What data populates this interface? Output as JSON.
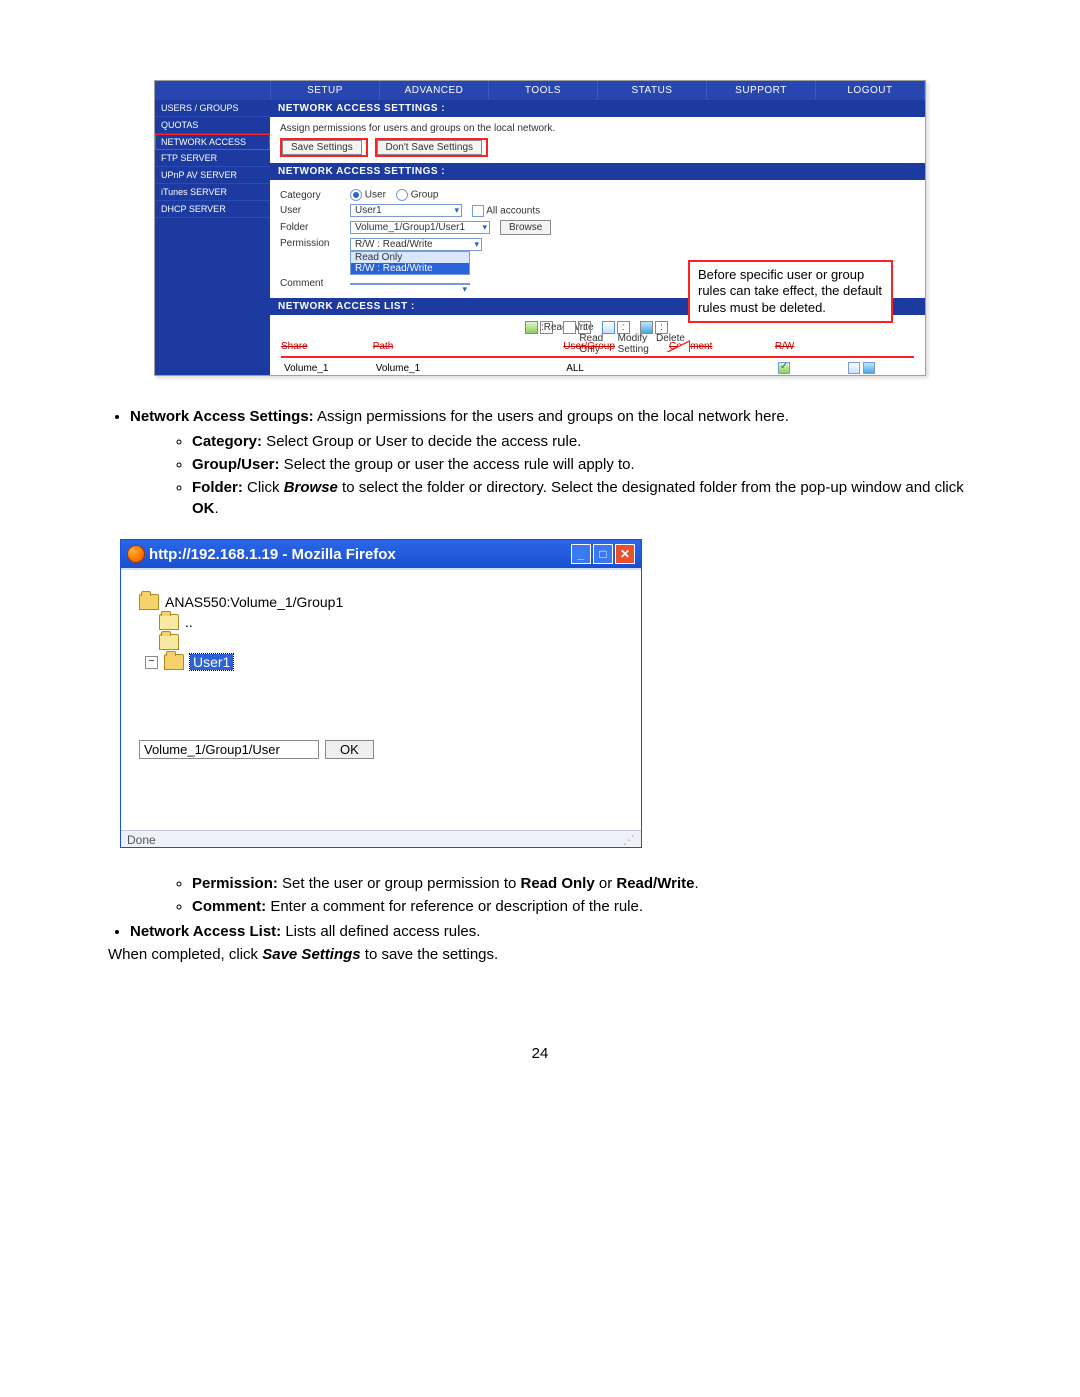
{
  "pageNumber": "24",
  "shot1": {
    "topnav": [
      "SETUP",
      "ADVANCED",
      "TOOLS",
      "STATUS",
      "SUPPORT",
      "LOGOUT"
    ],
    "side": [
      "USERS / GROUPS",
      "QUOTAS",
      "NETWORK ACCESS",
      "FTP SERVER",
      "UPnP AV SERVER",
      "iTunes SERVER",
      "DHCP SERVER"
    ],
    "sideActiveIndex": 2,
    "nas_title": "NETWORK ACCESS SETTINGS :",
    "nas_sub": "Assign permissions for users and groups on the local network.",
    "btn_save": "Save Settings",
    "btn_dontsave": "Don't Save Settings",
    "form": {
      "category_lbl": "Category",
      "user_radio": "User",
      "group_radio": "Group",
      "user_lbl": "User",
      "user_val": "User1",
      "all_accounts": "All accounts",
      "folder_lbl": "Folder",
      "folder_val": "Volume_1/Group1/User1",
      "browse": "Browse",
      "perm_lbl": "Permission",
      "perm_val": "R/W : Read/Write",
      "perm_opt1": "Read Only",
      "perm_opt2": "R/W : Read/Write",
      "comment_lbl": "Comment"
    },
    "list_title": "NETWORK ACCESS LIST :",
    "legend": {
      "rw": ":Read/Write",
      "ro": ": Read Only",
      "mod": ": Modify Setting",
      "del": ": Delete"
    },
    "list_headers": [
      "Share",
      "Path",
      "User/Group",
      "Comment",
      "R/W"
    ],
    "list_row": {
      "share": "Volume_1",
      "path": "Volume_1",
      "ug": "ALL",
      "comment": "",
      "checked": true
    },
    "callout": "Before specific user or group rules can take effect, the default rules must be deleted."
  },
  "desc": {
    "b1_bold": "Network Access Settings:",
    "b1_text": " Assign permissions for the users and groups on the local network here.",
    "s1_bold": "Category:",
    "s1_text": " Select Group or User to decide the access rule.",
    "s2_bold": "Group/User:",
    "s2_text": " Select the group or user the access rule will apply to.",
    "s3_bold": "Folder:",
    "s3_text1": " Click ",
    "s3_bi": "Browse",
    "s3_text2": " to select the folder or directory. Select the designated folder from the pop-up window and click ",
    "s3_bold2": "OK",
    "s3_text3": "."
  },
  "shot2": {
    "title": "http://192.168.1.19 - Mozilla Firefox",
    "root": "ANAS550:Volume_1/Group1",
    "dotdot": "..",
    "selected": "User1",
    "path": "Volume_1/Group1/User",
    "ok": "OK",
    "status": "Done"
  },
  "desc2": {
    "s4_bold": "Permission:",
    "s4_text1": " Set the user or group permission to ",
    "s4_b1": "Read Only",
    "s4_or": " or ",
    "s4_b2": "Read/Write",
    "s4_dot": ".",
    "s5_bold": "Comment:",
    "s5_text": " Enter a comment for reference or description of the rule.",
    "b2_bold": "Network Access List:",
    "b2_text": " Lists all defined access rules.",
    "final1": "When completed, click ",
    "final_bi": "Save Settings",
    "final2": " to save the settings."
  }
}
